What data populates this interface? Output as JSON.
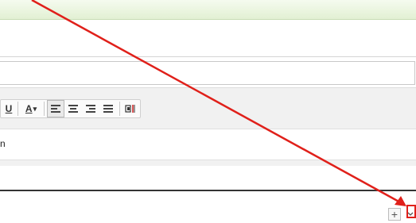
{
  "toolbar": {
    "underline_label": "U",
    "font_color_label": "A",
    "font_color_caret": "▾"
  },
  "editor": {
    "content": "n"
  },
  "actions": {
    "add_label": "+"
  },
  "colors": {
    "annotation_red": "#e0201a",
    "topbar_green": "#e2f0d3"
  }
}
